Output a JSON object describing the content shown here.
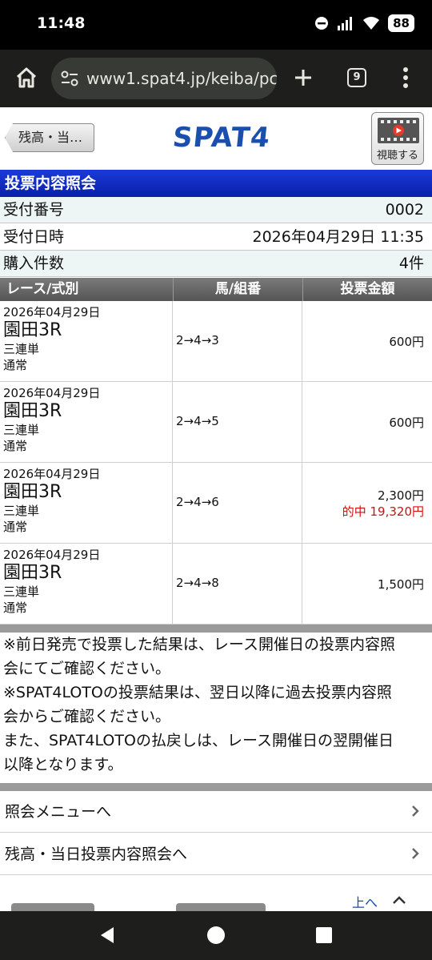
{
  "status": {
    "time": "11:48",
    "battery": "88"
  },
  "browser": {
    "url": "www1.spat4.jp/keiba/pc?",
    "tab_count": "9"
  },
  "header": {
    "back_label": "残高・当…",
    "logo": "SPAT4",
    "video_label": "視聴する"
  },
  "section_title": "投票内容照会",
  "info": [
    {
      "label": "受付番号",
      "value": "0002"
    },
    {
      "label": "受付日時",
      "value": "2026年04月29日 11:35"
    },
    {
      "label": "購入件数",
      "value": "4件"
    }
  ],
  "table_headers": [
    "レース/式別",
    "馬/組番",
    "投票金額"
  ],
  "bets": [
    {
      "date": "2026年04月29日",
      "venue": "園田3R",
      "type": "三連単",
      "kind": "通常",
      "combo": "2→4→3",
      "amount": "600円",
      "payout": ""
    },
    {
      "date": "2026年04月29日",
      "venue": "園田3R",
      "type": "三連単",
      "kind": "通常",
      "combo": "2→4→5",
      "amount": "600円",
      "payout": ""
    },
    {
      "date": "2026年04月29日",
      "venue": "園田3R",
      "type": "三連単",
      "kind": "通常",
      "combo": "2→4→6",
      "amount": "2,300円",
      "payout": "的中  19,320円"
    },
    {
      "date": "2026年04月29日",
      "venue": "園田3R",
      "type": "三連単",
      "kind": "通常",
      "combo": "2→4→8",
      "amount": "1,500円",
      "payout": ""
    }
  ],
  "notes": [
    "※前日発売で投票した結果は、レース開催日の投票内容照",
    "会にてご確認ください。",
    "※SPAT4LOTOの投票結果は、翌日以降に過去投票内容照",
    "会からご確認ください。",
    "また、SPAT4LOTOの払戻しは、レース開催日の翌開催日",
    "以降となります。"
  ],
  "menu_links": [
    "照会メニューへ",
    "残高・当日投票内容照会へ"
  ],
  "top_link": "上へ",
  "colors": {
    "title_blue": "#0a1faa",
    "payout_red": "#d01010",
    "logo_blue": "#1b4fae"
  }
}
